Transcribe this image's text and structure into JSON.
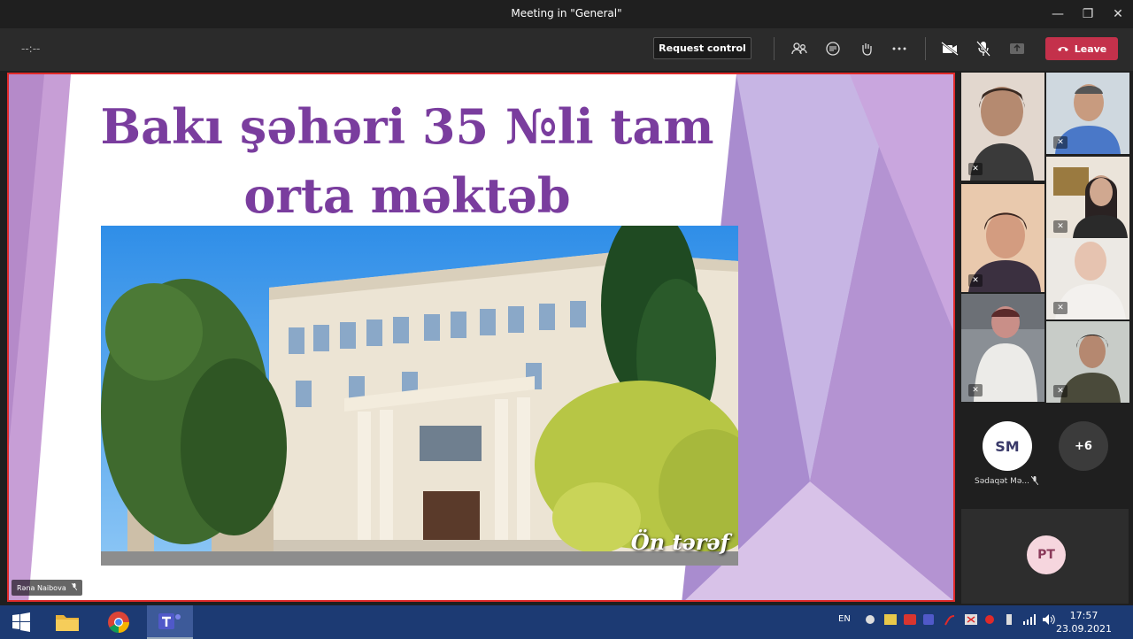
{
  "window": {
    "title": "Meeting in \"General\"",
    "minimize": "—",
    "maximize": "❐",
    "close": "✕"
  },
  "toolbar": {
    "timer": "--:--",
    "request_control": "Request control",
    "leave_label": "Leave"
  },
  "slide": {
    "title_line1": "Bakı şəhəri 35 №li tam",
    "title_line2": "orta məktəb",
    "caption": "Ön tərəf"
  },
  "presenter": {
    "name": "Rəna Naibova"
  },
  "participants": {
    "sm_initials": "SM",
    "sm_name": "Sədaqət Mə...",
    "overflow": "+6",
    "pt_initials": "PT"
  },
  "taskbar": {
    "lang": "EN",
    "time": "17:57",
    "date": "23.09.2021"
  },
  "colors": {
    "title_purple": "#7a3d9e",
    "leave_red": "#c4314b",
    "share_border": "#e02a2a",
    "taskbar_blue": "#1c3a73"
  }
}
